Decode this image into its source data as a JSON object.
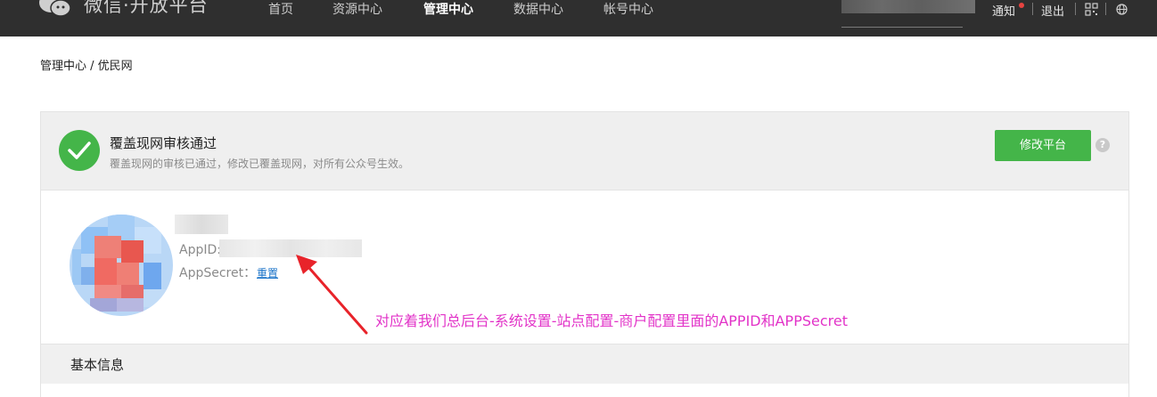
{
  "topbar": {
    "logo_text": "微信·开放平台",
    "nav": [
      "首页",
      "资源中心",
      "管理中心",
      "数据中心",
      "帐号中心"
    ],
    "active_nav": "管理中心",
    "notice_label": "通知",
    "logout_label": "退出",
    "icons": [
      "qrcode-icon",
      "globe-icon"
    ]
  },
  "breadcrumb": "管理中心 / 优民网",
  "status": {
    "title": "覆盖现网审核通过",
    "description": "覆盖现网的审核已通过，修改已覆盖现网，对所有公众号生效。",
    "modify_button": "修改平台",
    "help_icon": "?"
  },
  "credentials": {
    "appid_label": "AppID:",
    "appsecret_label": "AppSecret：",
    "reset_link": "重置"
  },
  "annotation": "对应着我们总后台-系统设置-站点配置-商户配置里面的APPID和APPSecret",
  "section": {
    "title": "基本信息"
  },
  "colors": {
    "topbar": "#2f2f2f",
    "primary_button": "#44b549",
    "check": "#44b549",
    "annotation": "#e233c8",
    "arrow": "#e8232a"
  }
}
